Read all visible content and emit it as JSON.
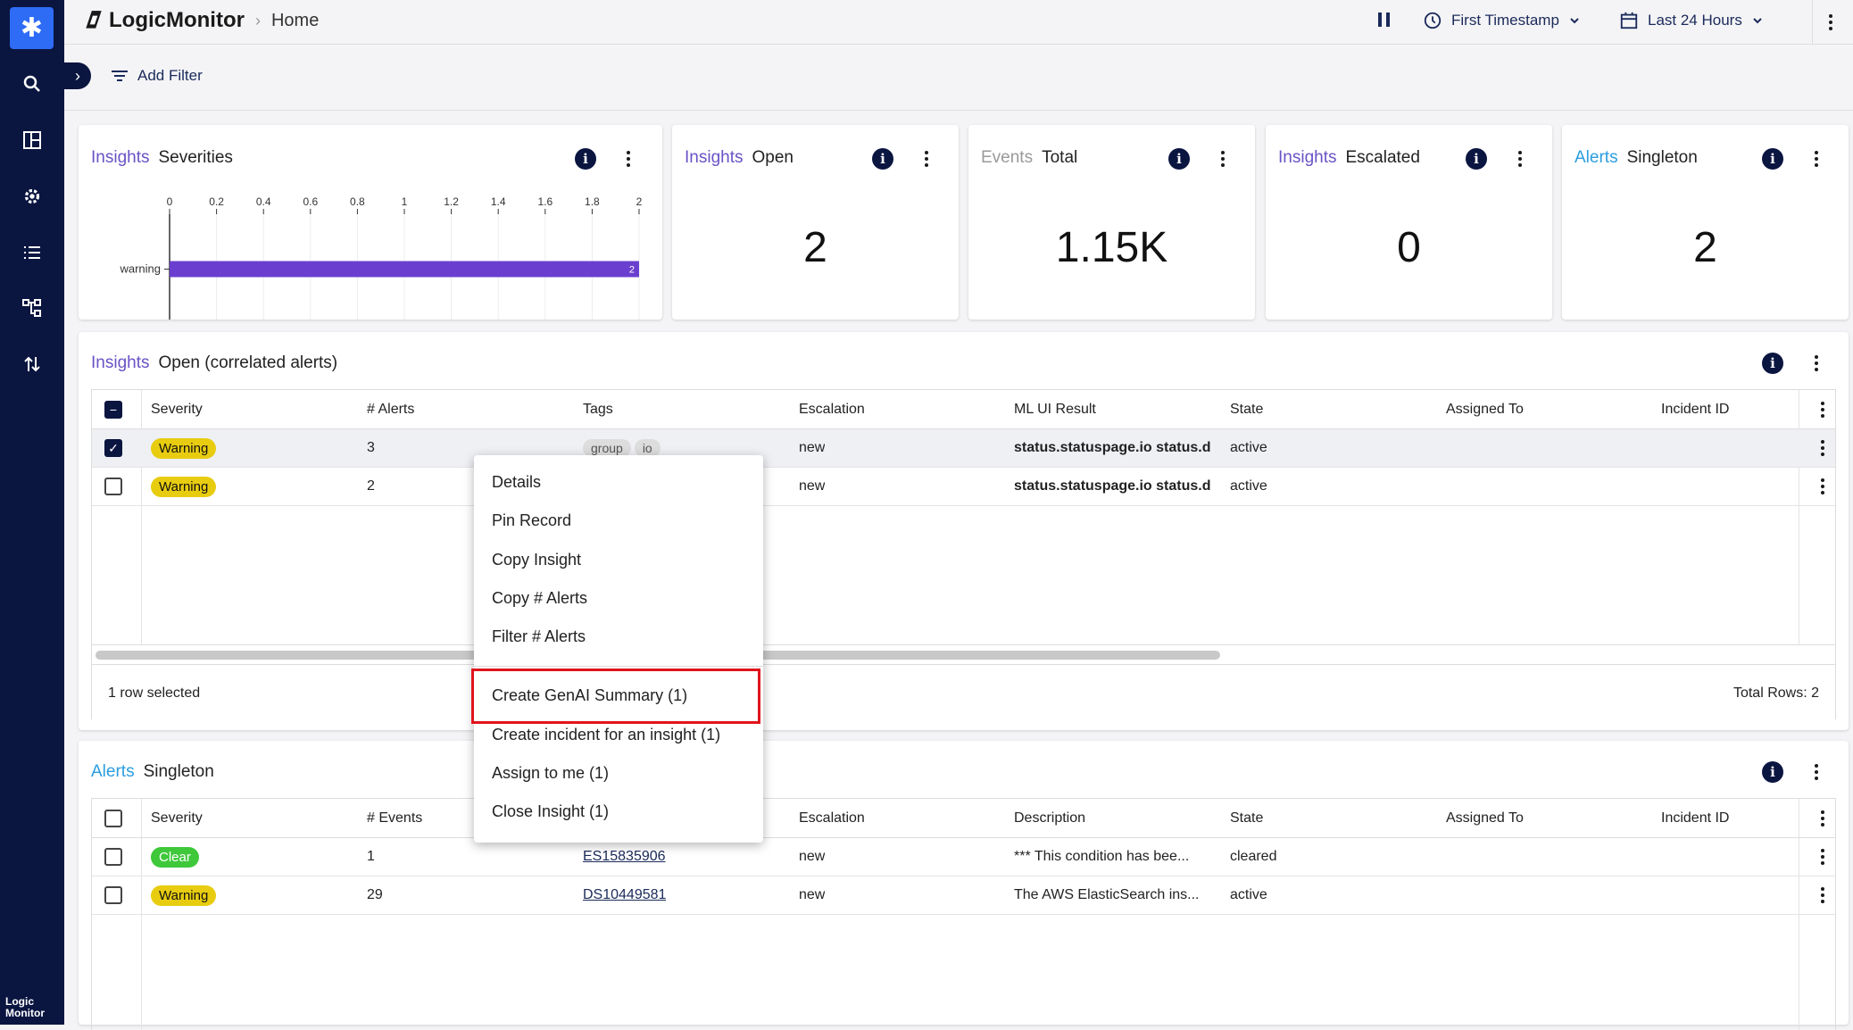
{
  "nav": {
    "footer_line1": "Logic",
    "footer_line2": "Monitor"
  },
  "header": {
    "brand": "LogicMonitor",
    "breadcrumb": "Home",
    "time_mode": "First Timestamp",
    "time_range": "Last 24 Hours"
  },
  "filterbar": {
    "add_filter": "Add Filter"
  },
  "cards": {
    "severities": {
      "kind": "Insights",
      "title": "Severities"
    },
    "open": {
      "kind": "Insights",
      "title": "Open",
      "value": "2"
    },
    "events": {
      "kind": "Events",
      "title": "Total",
      "value": "1.15K"
    },
    "escalated": {
      "kind": "Insights",
      "title": "Escalated",
      "value": "0"
    },
    "singleton": {
      "kind": "Alerts",
      "title": "Singleton",
      "value": "2"
    }
  },
  "chart_data": {
    "type": "bar",
    "orientation": "horizontal",
    "categories": [
      "warning"
    ],
    "values": [
      2
    ],
    "data_labels": [
      "2"
    ],
    "xlim": [
      0,
      2
    ],
    "ticks": [
      "0",
      "0.2",
      "0.4",
      "0.6",
      "0.8",
      "1",
      "1.2",
      "1.4",
      "1.6",
      "1.8",
      "2"
    ],
    "color": "#6a3fd0",
    "grid": true
  },
  "insights_table": {
    "kind": "Insights",
    "title": "Open (correlated alerts)",
    "columns": [
      "Severity",
      "# Alerts",
      "Tags",
      "Escalation",
      "ML UI Result",
      "State",
      "Assigned To",
      "Incident ID"
    ],
    "rows": [
      {
        "severity": "Warning",
        "alerts": "3",
        "tag1": "group",
        "tag2": "io",
        "escalation": "new",
        "ml": "status.statuspage.io status.d",
        "state": "active"
      },
      {
        "severity": "Warning",
        "alerts": "2",
        "escalation": "new",
        "ml": "status.statuspage.io status.d",
        "state": "active"
      }
    ],
    "footer_left": "1 row selected",
    "footer_right": "Total Rows: 2"
  },
  "alerts_table": {
    "kind": "Alerts",
    "title": "Singleton",
    "columns": [
      "Severity",
      "# Events",
      "Escalation",
      "Description",
      "State",
      "Assigned To",
      "Incident ID"
    ],
    "rows": [
      {
        "severity": "Clear",
        "events": "1",
        "id": "ES15835906",
        "escalation": "new",
        "description": "*** This condition has bee...",
        "state": "cleared"
      },
      {
        "severity": "Warning",
        "events": "29",
        "id": "DS10449581",
        "escalation": "new",
        "description": "The AWS ElasticSearch ins...",
        "state": "active"
      }
    ]
  },
  "context_menu": {
    "items": [
      "Details",
      "Pin Record",
      "Copy Insight",
      "Copy # Alerts",
      "Filter # Alerts",
      "Create GenAI Summary (1)",
      "Create incident for an insight (1)",
      "Assign to me (1)",
      "Close Insight (1)"
    ],
    "highlight_color": "#e0141c"
  },
  "colors": {
    "nav_bg": "#0a1540",
    "accent_blue": "#2e6cf6",
    "insights_purple": "#6a52c6",
    "alerts_blue": "#2a9de0",
    "warning_yellow": "#e8cc10",
    "clear_green": "#3ec83a"
  }
}
